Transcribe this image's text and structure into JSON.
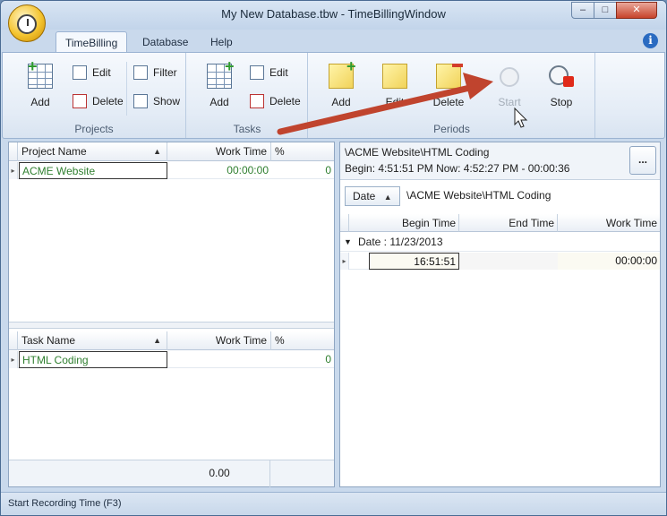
{
  "window": {
    "title": "My New Database.tbw - TimeBillingWindow",
    "minimize_glyph": "–",
    "maximize_glyph": "□",
    "close_glyph": "✕"
  },
  "ribbon_tabs": [
    {
      "label": "TimeBilling"
    },
    {
      "label": "Database"
    },
    {
      "label": "Help"
    }
  ],
  "info_glyph": "i",
  "ribbon": {
    "projects": {
      "label": "Projects",
      "add": "Add",
      "edit": "Edit",
      "delete": "Delete",
      "filter": "Filter",
      "show": "Show"
    },
    "tasks": {
      "label": "Tasks",
      "add": "Add",
      "edit": "Edit",
      "delete": "Delete"
    },
    "periods": {
      "label": "Periods",
      "add": "Add",
      "edit": "Edit",
      "delete": "Delete",
      "start": "Start",
      "stop": "Stop"
    }
  },
  "projects_grid": {
    "columns": [
      "Project Name",
      "Work Time",
      "%"
    ],
    "rows": [
      {
        "name": "ACME Website",
        "work_time": "00:00:00",
        "percent": "0"
      }
    ]
  },
  "tasks_grid": {
    "columns": [
      "Task Name",
      "Work Time",
      "%"
    ],
    "rows": [
      {
        "name": "HTML Coding",
        "work_time": "",
        "percent": "0"
      }
    ],
    "footer_total": "0.00"
  },
  "period_panel": {
    "path": "\\ACME Website\\HTML Coding",
    "begin_now": "Begin: 4:51:51 PM Now: 4:52:27 PM - 00:00:36",
    "more_label": "...",
    "group_chip": "Date",
    "group_path": "\\ACME Website\\HTML Coding",
    "columns": [
      "Begin Time",
      "End Time",
      "Work Time"
    ],
    "group_row": "Date : 11/23/2013",
    "rows": [
      {
        "begin": "16:51:51",
        "end": "",
        "work": "00:00:00"
      }
    ]
  },
  "status": {
    "text": "Start Recording Time (F3)"
  },
  "colors": {
    "accent_green": "#2f7f2f",
    "annotation_arrow": "#c0442e"
  }
}
